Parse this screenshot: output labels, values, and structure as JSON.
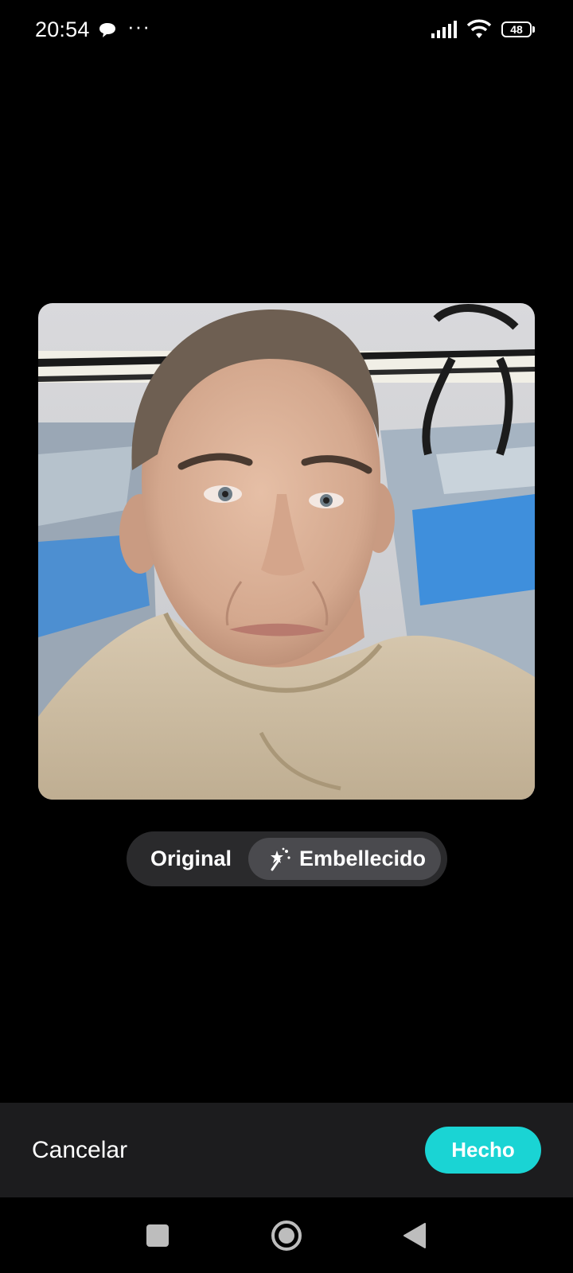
{
  "status_bar": {
    "time": "20:54",
    "notification_icon": "chat-bubble-icon",
    "more_indicator": "···",
    "signal_icon": "cellular-signal-icon",
    "wifi_icon": "wifi-icon",
    "battery_level": "48"
  },
  "preview": {
    "image_icon": "portrait-photo"
  },
  "mode_toggle": {
    "original_label": "Original",
    "enhanced_label": "Embellecido",
    "enhanced_icon": "magic-wand-icon",
    "selected": "Embellecido"
  },
  "actions": {
    "cancel_label": "Cancelar",
    "done_label": "Hecho",
    "done_color": "#1ad4d4"
  },
  "nav_bar": {
    "recents_icon": "square-icon",
    "home_icon": "circle-icon",
    "back_icon": "triangle-back-icon"
  }
}
